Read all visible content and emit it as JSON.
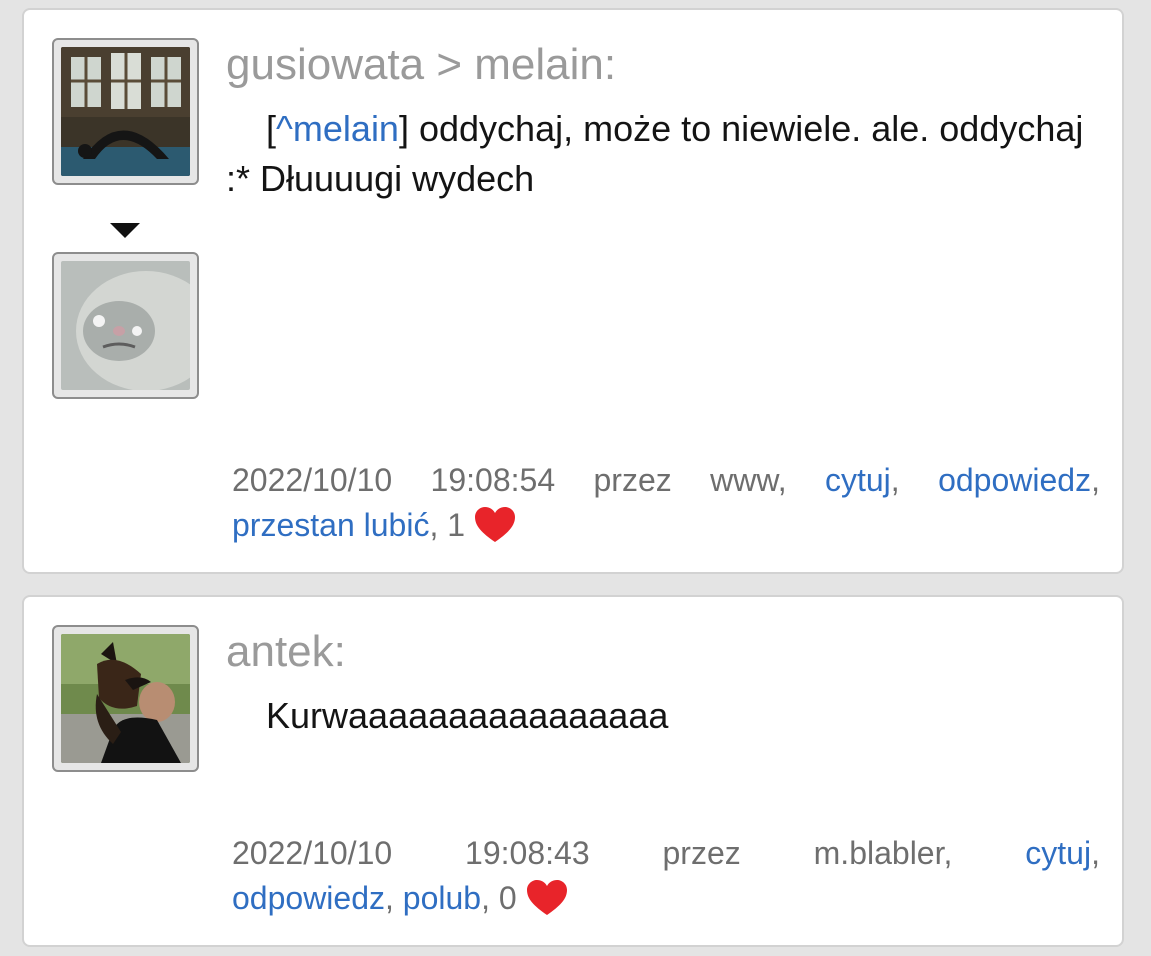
{
  "posts": [
    {
      "author": "gusiowata > melain:",
      "mention": "^melain",
      "bracket_open": "[",
      "bracket_close": "]",
      "content_rest": " oddychaj, może to niewiele. ale. oddychaj :* Dłuuuugi wydech",
      "date": "2022/10/10",
      "time": "19:08:54",
      "via": "przez",
      "source": "www,",
      "quote_label": "cytuj",
      "reply_label": "odpowiedz",
      "like_label": "przestan lubić",
      "sep": ",",
      "likes_count": "1"
    },
    {
      "author": "antek:",
      "content": "Kurwaaaaaaaaaaaaaaaa",
      "date": "2022/10/10",
      "time": "19:08:43",
      "via": "przez",
      "source": "m.blabler,",
      "quote_label": "cytuj",
      "reply_label": "odpowiedz",
      "like_label": "polub",
      "sep": ",",
      "likes_count": "0"
    }
  ],
  "icons": {
    "heart": "heart-icon",
    "caret": "caret-down-icon"
  },
  "colors": {
    "link": "#2f6ec2",
    "heart": "#e8242a",
    "author": "#9a9a9a",
    "meta": "#6e6e6e"
  }
}
